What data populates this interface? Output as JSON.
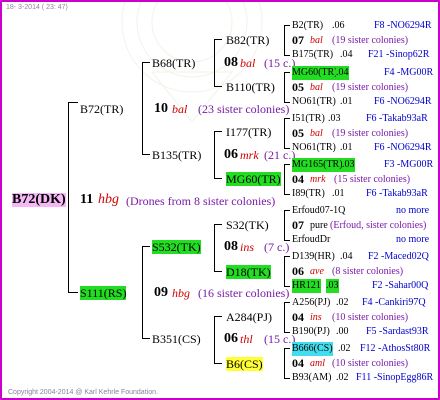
{
  "header": {
    "date": "18-  3-2014 ( 23: 47)"
  },
  "footer": {
    "copyright": "Copyright 2004-2014 @ Karl Kehrle Foundation."
  },
  "root": {
    "name": "B72(DK)",
    "gen": "11",
    "hbg": "hbg",
    "info": "(Drones from 8 sister colonies)"
  },
  "g1": {
    "upper": {
      "name": "B72(TR)",
      "gen": "10",
      "hbg": "bal",
      "info": "(23 sister colonies)"
    },
    "lower": {
      "name": "S111(RS)",
      "gen": "09",
      "hbg": "hbg",
      "info": "(16 sister colonies)"
    }
  },
  "g2": {
    "a": {
      "name": "B68(TR)",
      "gen": "08",
      "hbg": "bal",
      "info": "(15 c.)"
    },
    "b": {
      "name": "B135(TR)",
      "gen": "06",
      "hbg": "mrk",
      "info": "(21 c.)"
    },
    "c": {
      "name": "S532(TK)",
      "gen": "08",
      "hbg": "ins",
      "info": "(7 c.)"
    },
    "d": {
      "name": "B351(CS)",
      "gen": "06",
      "hbg": "thl",
      "info": "(15 c.)"
    }
  },
  "g3": [
    {
      "name": "B82(TR)"
    },
    {
      "name": "B110(TR)"
    },
    {
      "name": "I177(TR)"
    },
    {
      "name": "MG60(TR)"
    },
    {
      "name": "S32(TK)"
    },
    {
      "name": "D18(TK)"
    },
    {
      "name": "A284(PJ)"
    },
    {
      "name": "B6(CS)"
    }
  ],
  "g4": [
    {
      "name": "B2(TR)",
      "num": ".06",
      "ref": "F8 -NO6294R"
    },
    {
      "gen": "07",
      "hbg": "bal",
      "info": "(19 sister colonies)"
    },
    {
      "name": "B175(TR)",
      "num": ".04",
      "ref": "F21 -Sinop62R"
    },
    {
      "name": "MG60(TR)",
      "num": ".04",
      "ref": "F4 -MG00R"
    },
    {
      "gen": "05",
      "hbg": "bal",
      "info": "(19 sister colonies)"
    },
    {
      "name": "NO61(TR)",
      "num": ".01",
      "ref": "F6 -NO6294R"
    },
    {
      "name": "I51(TR)",
      "num": ".03",
      "ref": "F6 -Takab93aR"
    },
    {
      "gen": "05",
      "hbg": "bal",
      "info": "(19 sister colonies)"
    },
    {
      "name": "NO61(TR)",
      "num": ".01",
      "ref": "F6 -NO6294R"
    },
    {
      "name": "MG165(TR)",
      "num": ".03",
      "ref": "F3 -MG00R"
    },
    {
      "gen": "04",
      "hbg": "mrk",
      "info": "(15 sister colonies)"
    },
    {
      "name": "I89(TR)",
      "num": ".01",
      "ref": "F6 -Takab93aR"
    },
    {
      "name": "Erfoud07-1Q",
      "num": "",
      "ref": "no more"
    },
    {
      "gen": "07",
      "hbg": "pure",
      "info": "(Erfoud, sister colonies)"
    },
    {
      "name": "ErfoudDr",
      "num": "",
      "ref": "no more"
    },
    {
      "name": "D139(HR)",
      "num": ".04",
      "ref": "F2 -Maced02Q"
    },
    {
      "gen": "06",
      "hbg": "ave",
      "info": "(8 sister colonies)"
    },
    {
      "name": "HR121",
      "num": ".03",
      "ref": "F2 -Sahar00Q"
    },
    {
      "name": "A256(PJ)",
      "num": ".02",
      "ref": "F4 -Cankiri97Q"
    },
    {
      "gen": "04",
      "hbg": "ins",
      "info": "(10 sister colonies)"
    },
    {
      "name": "B190(PJ)",
      "num": ".00",
      "ref": "F5 -Sardast93R"
    },
    {
      "name": "B666(CS)",
      "num": ".02",
      "ref": "F12 -AthosSt80R"
    },
    {
      "gen": "04",
      "hbg": "aml",
      "info": "(10 sister colonies)"
    },
    {
      "name": "B93(AM)",
      "num": ".02",
      "ref": "F11 -SinopEgg86R"
    }
  ],
  "colors": {
    "frame": "#cc00cc",
    "green": "#22dd22",
    "yellow": "#ffff33",
    "pink": "#f5b8f5",
    "cyan": "#44ddee",
    "red": "#d00000",
    "blue": "#0000cc",
    "purple": "#7a1aa8"
  }
}
